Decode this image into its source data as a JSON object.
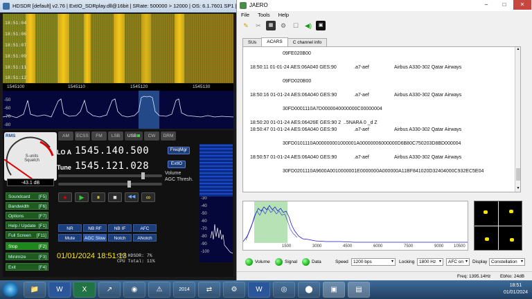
{
  "hdsdr": {
    "title": "HDSDR  [default]  v2.76   |  ExtIO_SDRplay.dll@16bit  |  SRate: 500000 > 12000  |  OS: 6.1.7601 SP1  |",
    "waterfall_times": [
      "18:51:04",
      "18:51:06",
      "18:51:07",
      "18:51:09",
      "18:51:11",
      "18:51:12"
    ],
    "freq_ticks": [
      "1545100",
      "1545110",
      "1545120",
      "1545130"
    ],
    "db_ticks": [
      "-50",
      "-60",
      "-70",
      "-80"
    ],
    "smeter": {
      "label": "RMS",
      "scale": "S-units\nSquelch",
      "value": "-43.1 dB"
    },
    "modes": [
      {
        "label": "AM",
        "on": false
      },
      {
        "label": "ECSS",
        "on": false
      },
      {
        "label": "FM",
        "on": false
      },
      {
        "label": "LSB",
        "on": false
      },
      {
        "label": "USB",
        "on": true
      },
      {
        "label": "CW",
        "on": false
      },
      {
        "label": "DRM",
        "on": false
      }
    ],
    "lo_label": "LO A",
    "lo_freq": "1545.140.500",
    "tune_label": "Tune",
    "tune_freq": "1545.121.028",
    "freqmgr": "FreqMgr",
    "extio": "ExtIO",
    "volume_label": "Volume",
    "agc_label": "AGC Thresh.",
    "fkeys": [
      {
        "label": "Soundcard",
        "key": "[F5]"
      },
      {
        "label": "Bandwidth",
        "key": "[F6]"
      },
      {
        "label": "Options",
        "key": "[F7]"
      },
      {
        "label": "Help / Update",
        "key": "[F1]"
      },
      {
        "label": "Full Screen",
        "key": "[F11]"
      },
      {
        "label": "Stop",
        "key": "[F2]"
      },
      {
        "label": "Minimize",
        "key": "[F3]"
      },
      {
        "label": "Exit",
        "key": "[F4]"
      }
    ],
    "transport": [
      "●",
      "▶",
      "⏸",
      "■",
      "◀◀",
      "∞"
    ],
    "nr_buttons": [
      "NR",
      "NB RF",
      "NB IF",
      "AFC",
      "Mute",
      "AGC Slow",
      "Notch",
      "ANotch"
    ],
    "clock": "01/01/2024 18:51:13",
    "cpu_hdsdr": "CPU HDSDR: 7%",
    "cpu_total": "CPU Total: 11%",
    "sub_db_ticks": [
      "-30",
      "-40",
      "-50",
      "-60",
      "-70",
      "-80",
      "-90",
      "-100"
    ]
  },
  "jaero": {
    "title": "JAERO",
    "menu": [
      "File",
      "Tools",
      "Help"
    ],
    "tabs": [
      "SUs",
      "ACARS",
      "C channel info"
    ],
    "active_tab": "ACARS",
    "messages": [
      {
        "kind": "data",
        "text": "09FE020B00"
      },
      {
        "kind": "line",
        "time": "18:50:11 01-01-24 AES:06A040 GES:90",
        "code": ".a7-aef",
        "aircraft": "Airbus A330-302 Qatar Airways"
      },
      {
        "kind": "data",
        "text": "09FD020B00"
      },
      {
        "kind": "line",
        "time": "18:50:16 01-01-24 AES:06A040 GES:90",
        "code": ".a7-aef",
        "aircraft": "Airbus A330-302 Qatar Airways"
      },
      {
        "kind": "data",
        "text": "30FD0001110A7D0000040000000C00000004"
      },
      {
        "kind": "line",
        "time": "18:50:20 01-01-24 AES:06426E GES:90 2  ..5NARA 0 _d Z",
        "code": "",
        "aircraft": ""
      },
      {
        "kind": "line",
        "time": "18:50:47 01-01-24 AES:06A040 GES:90",
        "code": ".a7-aef",
        "aircraft": "Airbus A330-302 Qatar Airways"
      },
      {
        "kind": "data",
        "text": "30FD0101110A000000001000001A00000006000000D6B80C750203D8BD000004"
      },
      {
        "kind": "line",
        "time": "18:50:57 01-01-24 AES:06A040 GES:90",
        "code": ".a7-aef",
        "aircraft": "Airbus A330-302 Qatar Airways"
      },
      {
        "kind": "data",
        "text": "30FD0201110A9600A0010000001E0000000A000000A11BF841020D32404000C932EC5E04"
      }
    ],
    "spectrum_ticks": [
      "1500",
      "3000",
      "4500",
      "6000",
      "7500",
      "9000",
      "10500"
    ],
    "status": {
      "volume": "Volume",
      "signal": "Signal",
      "data": "Data",
      "speed_label": "Speed",
      "speed": "1200 bps",
      "locking_label": "Locking",
      "locking": "1800 Hz",
      "afc": "AFC on",
      "display_label": "Display",
      "display": "Constellation"
    },
    "freq": "Freq: 1395.14Hz",
    "ebno": "EbNo: 24dB"
  },
  "taskbar": {
    "apps": [
      "📁",
      "W",
      "X",
      "↗",
      "◉",
      "⚠",
      "2014",
      "⇄",
      "⚙",
      "W",
      "◎",
      "⬤",
      "▣",
      "▤"
    ],
    "time": "18:51",
    "date": "01/01/2024"
  },
  "colors": {
    "hdsdr_bg": "#1a1a1a",
    "lo_text": "#ffffff",
    "clock": "#ffeb00",
    "led": "#22bb22",
    "constellation": "#f5e400"
  }
}
